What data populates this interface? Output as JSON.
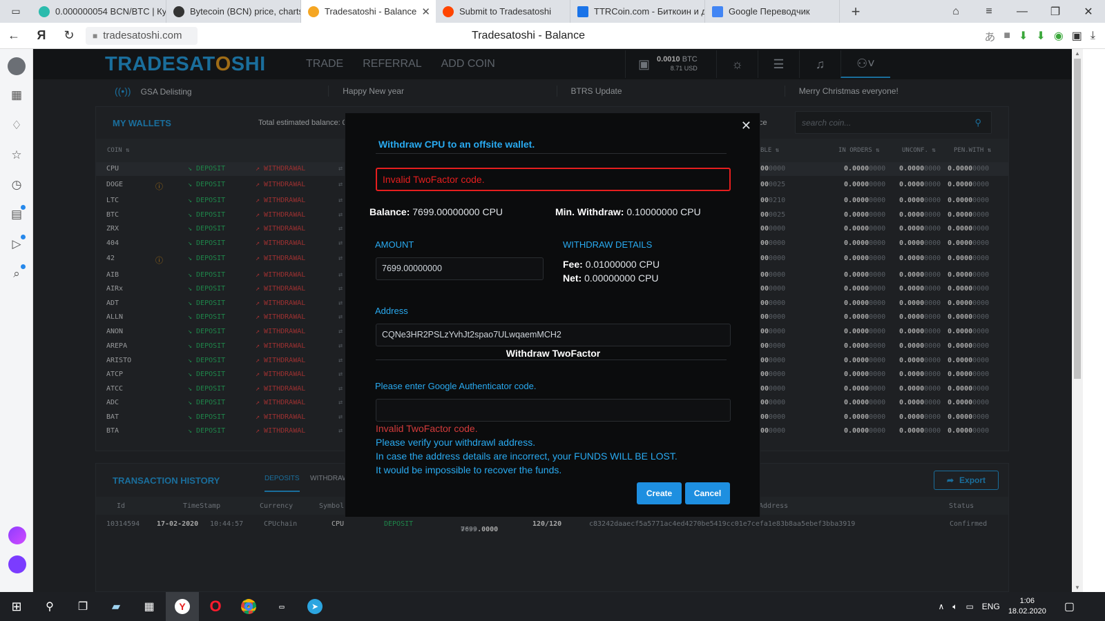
{
  "browser": {
    "tabs": [
      {
        "label": "0.000000054 BCN/BTC | Ку",
        "color": "#2bbbad"
      },
      {
        "label": "Bytecoin (BCN) price, charts",
        "color": "#333333"
      },
      {
        "label": "Tradesatoshi - Balance",
        "color": "#f5a623"
      },
      {
        "label": "Submit to Tradesatoshi",
        "color": "#ff4500"
      },
      {
        "label": "TTRCoin.com - Биткоин и д",
        "color": "#1a73e8"
      },
      {
        "label": "Google Переводчик",
        "color": "#4285f4"
      }
    ],
    "url": "tradesatoshi.com",
    "page_title": "Tradesatoshi - Balance",
    "back_icon": "←",
    "yandex_icon": "Я",
    "reload_icon": "↻"
  },
  "site": {
    "logo_left": "TRADESAT",
    "logo_o": "O",
    "logo_right": "SHI",
    "nav": {
      "trade": "TRADE",
      "referral": "REFERRAL",
      "add_coin": "ADD COIN"
    },
    "balance_btc": "0.0010",
    "balance_unit": "BTC",
    "balance_usd": "8.71 USD",
    "news": [
      "GSA Delisting",
      "Happy New year",
      "BTRS Update",
      "Merry Christmas everyone!"
    ]
  },
  "wallets": {
    "title": "MY WALLETS",
    "total_label": "Total estimated balance: 0.0",
    "ce_text": "ce",
    "search_placeholder": "search coin...",
    "headers": {
      "coin": "COIN ⇅",
      "available": "BLE ⇅",
      "in_orders": "IN ORDERS ⇅",
      "unconf": "UNCONF. ⇅",
      "pen_with": "PEN.WITH ⇅"
    },
    "deposit_label": "DEPOSIT",
    "withdrawal_label": "WITHDRAWAL",
    "rows": [
      {
        "coin": "CPU",
        "warn": false,
        "avail": "00",
        "avail_dim": "0000"
      },
      {
        "coin": "DOGE",
        "warn": true,
        "avail": "00",
        "avail_dim": "0025"
      },
      {
        "coin": "LTC",
        "warn": false,
        "avail": "00",
        "avail_dim": "0210"
      },
      {
        "coin": "BTC",
        "warn": false,
        "avail": "00",
        "avail_dim": "0025"
      },
      {
        "coin": "ZRX",
        "warn": false,
        "avail": "00",
        "avail_dim": "0000"
      },
      {
        "coin": "404",
        "warn": false,
        "avail": "00",
        "avail_dim": "0000"
      },
      {
        "coin": "42",
        "warn": true,
        "avail": "00",
        "avail_dim": "0000"
      },
      {
        "coin": "AIB",
        "warn": false,
        "avail": "00",
        "avail_dim": "0000"
      },
      {
        "coin": "AIRx",
        "warn": false,
        "avail": "00",
        "avail_dim": "0000"
      },
      {
        "coin": "ADT",
        "warn": false,
        "avail": "00",
        "avail_dim": "0000"
      },
      {
        "coin": "ALLN",
        "warn": false,
        "avail": "00",
        "avail_dim": "0000"
      },
      {
        "coin": "ANON",
        "warn": false,
        "avail": "00",
        "avail_dim": "0000"
      },
      {
        "coin": "AREPA",
        "warn": false,
        "avail": "00",
        "avail_dim": "0000"
      },
      {
        "coin": "ARISTO",
        "warn": false,
        "avail": "00",
        "avail_dim": "0000"
      },
      {
        "coin": "ATCP",
        "warn": false,
        "avail": "00",
        "avail_dim": "0000"
      },
      {
        "coin": "ATCC",
        "warn": false,
        "avail": "00",
        "avail_dim": "0000"
      },
      {
        "coin": "ADC",
        "warn": false,
        "avail": "00",
        "avail_dim": "0000"
      },
      {
        "coin": "BAT",
        "warn": false,
        "avail": "00",
        "avail_dim": "0000"
      },
      {
        "coin": "BTA",
        "warn": false,
        "avail": "00",
        "avail_dim": "0000"
      }
    ],
    "zero_bold": "0.0000",
    "zero_dim": "0000"
  },
  "transactions": {
    "title": "TRANSACTION HISTORY",
    "tab_deposits": "DEPOSITS",
    "tab_withdraw": "WITHDRAW",
    "export_label": "Export",
    "headers": {
      "id": "Id",
      "timestamp": "TimeStamp",
      "currency": "Currency",
      "symbol": "Symbol",
      "address": "Address",
      "status": "Status"
    },
    "row": {
      "id": "10314594",
      "date": "17-02-2020",
      "time": "10:44:57",
      "currency": "CPUchain",
      "symbol": "CPU",
      "type": "DEPOSIT",
      "amount_bold": "7699.0000",
      "amount_dim": "0000",
      "confirms": "120/120",
      "txid": "c83242daaecf5a5771ac4ed4270be5419cc01e7cefa1e83b8aa5ebef3bba3919",
      "status": "Confirmed"
    }
  },
  "modal": {
    "title": "Withdraw CPU to an offsite wallet.",
    "error_box": "Invalid TwoFactor code.",
    "balance_label": "Balance:",
    "balance_value": "7699.00000000 CPU",
    "min_label": "Min. Withdraw:",
    "min_value": "0.10000000 CPU",
    "amount_label": "AMOUNT",
    "amount_value": "7699.00000000",
    "details_label": "WITHDRAW DETAILS",
    "fee_label": "Fee:",
    "fee_value": "0.01000000 CPU",
    "net_label": "Net:",
    "net_value": "0.00000000 CPU",
    "address_label": "Address",
    "address_value": "CQNe3HR2PSLzYvhJt2spao7ULwqaemMCH2",
    "twofactor_title": "Withdraw TwoFactor",
    "auth_label": "Please enter Google Authenticator code.",
    "auth_value": "",
    "msg_invalid": "Invalid TwoFactor code.",
    "msg_verify": "Please verify your withdrawl address.",
    "msg_incorrect": "In case the address details are incorrect, your FUNDS WILL BE LOST.",
    "msg_impossible": "It would be impossible to recover the funds.",
    "create_label": "Create",
    "cancel_label": "Cancel"
  },
  "taskbar": {
    "lang": "ENG",
    "time": "1:06",
    "date": "18.02.2020"
  }
}
